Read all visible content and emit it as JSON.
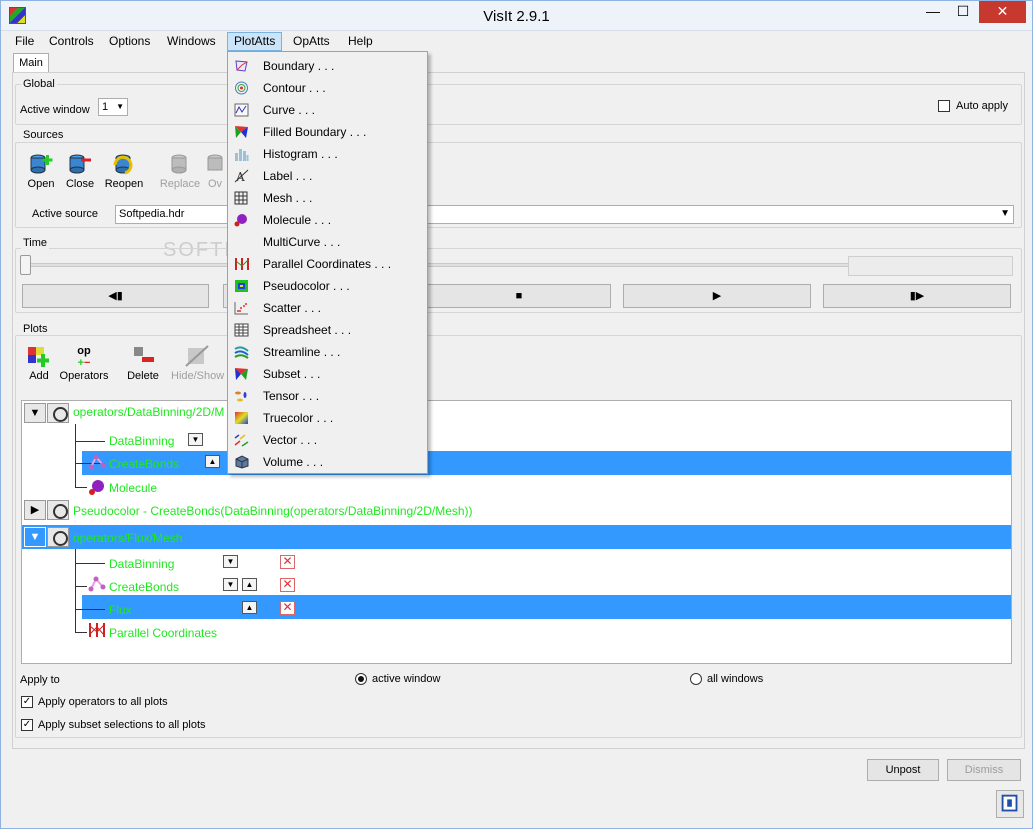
{
  "window": {
    "title": "VisIt 2.9.1"
  },
  "menu": [
    "File",
    "Controls",
    "Options",
    "Windows",
    "PlotAtts",
    "OpAtts",
    "Help"
  ],
  "tab": "Main",
  "global": {
    "title": "Global",
    "active_window_label": "Active window",
    "active_window_value": "1",
    "auto_apply": "Auto apply"
  },
  "sources": {
    "title": "Sources",
    "tools": [
      "Open",
      "Close",
      "Reopen",
      "Replace",
      "Ov"
    ],
    "active_source_label": "Active source",
    "active_source_value": "Softpedia.hdr"
  },
  "time": {
    "title": "Time",
    "buttons": [
      "◀▮",
      "▶",
      "■",
      "▶",
      "▮▶"
    ]
  },
  "plots": {
    "title": "Plots",
    "tools": [
      "Add",
      "Operators",
      "Delete",
      "Hide/Show"
    ],
    "op_glyph": "op",
    "tree": [
      {
        "label": "operators/DataBinning/2D/M",
        "kind": "plot"
      },
      {
        "label": "DataBinning",
        "kind": "op"
      },
      {
        "label": "CreateBonds",
        "kind": "op"
      },
      {
        "label": "Molecule",
        "kind": "plottype"
      },
      {
        "label": "Pseudocolor - CreateBonds(DataBinning(operators/DataBinning/2D/Mesh))",
        "kind": "plot"
      },
      {
        "label": "operators/Flux/Mesh",
        "kind": "plot"
      },
      {
        "label": "DataBinning",
        "kind": "op"
      },
      {
        "label": "CreateBonds",
        "kind": "op"
      },
      {
        "label": "Flux",
        "kind": "op"
      },
      {
        "label": "Parallel Coordinates",
        "kind": "plottype"
      }
    ],
    "expander_open": "▼",
    "expander_closed": "▶",
    "down_glyph": "▼",
    "up_glyph": "▲",
    "x_glyph": "✕"
  },
  "apply": {
    "label": "Apply to",
    "active_window": "active window",
    "all_windows": "all windows",
    "ops_all": "Apply operators to all plots",
    "subset_all": "Apply subset selections to all plots",
    "check_glyph": "✓"
  },
  "buttons": {
    "unpost": "Unpost",
    "dismiss": "Dismiss"
  },
  "plotatts_menu": [
    "Boundary . . .",
    "Contour . . .",
    "Curve . . .",
    "Filled Boundary . . .",
    "Histogram . . .",
    "Label . . .",
    "Mesh . . .",
    "Molecule . . .",
    "MultiCurve . . .",
    "Parallel Coordinates . . .",
    "Pseudocolor . . .",
    "Scatter . . .",
    "Spreadsheet . . .",
    "Streamline . . .",
    "Subset . . .",
    "Tensor . . .",
    "Truecolor . . .",
    "Vector . . .",
    "Volume . . ."
  ],
  "watermark": "SOFTPEDIA",
  "titlebar": {
    "min": "—",
    "max": "☐",
    "close": "✕"
  },
  "colors": {
    "selection": "#3399ff",
    "node_text": "#1fe81f",
    "menu_highlight": "#cce4f7"
  }
}
